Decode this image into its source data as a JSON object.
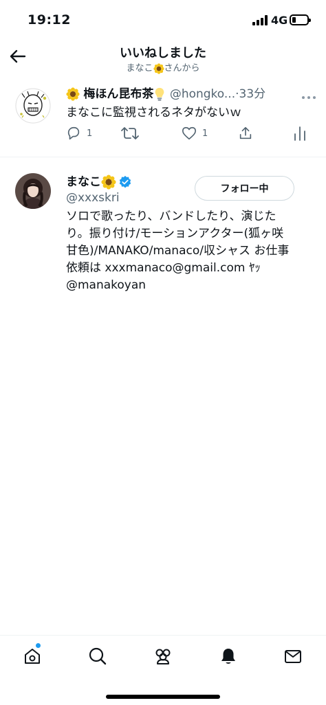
{
  "status_bar": {
    "time": "19:12",
    "network": "4G",
    "battery_level": 0.25
  },
  "header": {
    "title": "いいねしました",
    "subtitle_before": "まなこ",
    "subtitle_after": "さんから"
  },
  "tweet": {
    "author_name": "梅ほん昆布茶",
    "author_handle": "@hongko...",
    "separator": "·",
    "time": "33分",
    "text": "まなこに監視されるネタがないｗ",
    "reply_count": "1",
    "like_count": "1"
  },
  "user": {
    "name": "まなこ",
    "handle": "@xxxskri",
    "follow_label": "フォロー中",
    "bio": [
      "ソロで歌ったり、バンドしたり、演じた",
      "り。振り付け/モーションアクター(狐ヶ咲",
      "甘色)/MANAKO/manaco/収シャス お仕事",
      "依頼は xxxmanaco@gmail.com ﾔｯ",
      "@manakoyan"
    ]
  },
  "colors": {
    "accent": "#1d9bf0",
    "secondary_text": "#536471",
    "sunflower": "#f5c518"
  },
  "icons": [
    "back-arrow-icon",
    "sunflower-emoji-icon",
    "light-bulb-emoji-icon",
    "verified-badge-icon",
    "reply-icon",
    "retweet-icon",
    "like-icon",
    "share-icon",
    "analytics-icon",
    "more-icon",
    "home-icon",
    "search-icon",
    "communities-icon",
    "notifications-icon",
    "messages-icon"
  ]
}
